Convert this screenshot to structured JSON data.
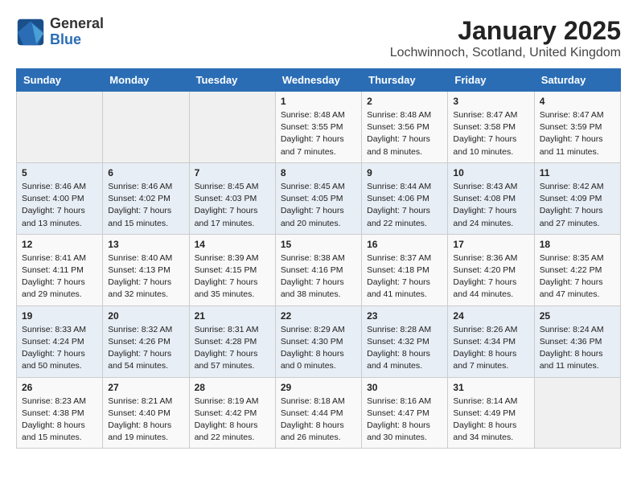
{
  "logo": {
    "general": "General",
    "blue": "Blue"
  },
  "title": "January 2025",
  "location": "Lochwinnoch, Scotland, United Kingdom",
  "days_of_week": [
    "Sunday",
    "Monday",
    "Tuesday",
    "Wednesday",
    "Thursday",
    "Friday",
    "Saturday"
  ],
  "weeks": [
    [
      {
        "day": null
      },
      {
        "day": null
      },
      {
        "day": null
      },
      {
        "day": "1",
        "sunrise": "Sunrise: 8:48 AM",
        "sunset": "Sunset: 3:55 PM",
        "daylight": "Daylight: 7 hours and 7 minutes."
      },
      {
        "day": "2",
        "sunrise": "Sunrise: 8:48 AM",
        "sunset": "Sunset: 3:56 PM",
        "daylight": "Daylight: 7 hours and 8 minutes."
      },
      {
        "day": "3",
        "sunrise": "Sunrise: 8:47 AM",
        "sunset": "Sunset: 3:58 PM",
        "daylight": "Daylight: 7 hours and 10 minutes."
      },
      {
        "day": "4",
        "sunrise": "Sunrise: 8:47 AM",
        "sunset": "Sunset: 3:59 PM",
        "daylight": "Daylight: 7 hours and 11 minutes."
      }
    ],
    [
      {
        "day": "5",
        "sunrise": "Sunrise: 8:46 AM",
        "sunset": "Sunset: 4:00 PM",
        "daylight": "Daylight: 7 hours and 13 minutes."
      },
      {
        "day": "6",
        "sunrise": "Sunrise: 8:46 AM",
        "sunset": "Sunset: 4:02 PM",
        "daylight": "Daylight: 7 hours and 15 minutes."
      },
      {
        "day": "7",
        "sunrise": "Sunrise: 8:45 AM",
        "sunset": "Sunset: 4:03 PM",
        "daylight": "Daylight: 7 hours and 17 minutes."
      },
      {
        "day": "8",
        "sunrise": "Sunrise: 8:45 AM",
        "sunset": "Sunset: 4:05 PM",
        "daylight": "Daylight: 7 hours and 20 minutes."
      },
      {
        "day": "9",
        "sunrise": "Sunrise: 8:44 AM",
        "sunset": "Sunset: 4:06 PM",
        "daylight": "Daylight: 7 hours and 22 minutes."
      },
      {
        "day": "10",
        "sunrise": "Sunrise: 8:43 AM",
        "sunset": "Sunset: 4:08 PM",
        "daylight": "Daylight: 7 hours and 24 minutes."
      },
      {
        "day": "11",
        "sunrise": "Sunrise: 8:42 AM",
        "sunset": "Sunset: 4:09 PM",
        "daylight": "Daylight: 7 hours and 27 minutes."
      }
    ],
    [
      {
        "day": "12",
        "sunrise": "Sunrise: 8:41 AM",
        "sunset": "Sunset: 4:11 PM",
        "daylight": "Daylight: 7 hours and 29 minutes."
      },
      {
        "day": "13",
        "sunrise": "Sunrise: 8:40 AM",
        "sunset": "Sunset: 4:13 PM",
        "daylight": "Daylight: 7 hours and 32 minutes."
      },
      {
        "day": "14",
        "sunrise": "Sunrise: 8:39 AM",
        "sunset": "Sunset: 4:15 PM",
        "daylight": "Daylight: 7 hours and 35 minutes."
      },
      {
        "day": "15",
        "sunrise": "Sunrise: 8:38 AM",
        "sunset": "Sunset: 4:16 PM",
        "daylight": "Daylight: 7 hours and 38 minutes."
      },
      {
        "day": "16",
        "sunrise": "Sunrise: 8:37 AM",
        "sunset": "Sunset: 4:18 PM",
        "daylight": "Daylight: 7 hours and 41 minutes."
      },
      {
        "day": "17",
        "sunrise": "Sunrise: 8:36 AM",
        "sunset": "Sunset: 4:20 PM",
        "daylight": "Daylight: 7 hours and 44 minutes."
      },
      {
        "day": "18",
        "sunrise": "Sunrise: 8:35 AM",
        "sunset": "Sunset: 4:22 PM",
        "daylight": "Daylight: 7 hours and 47 minutes."
      }
    ],
    [
      {
        "day": "19",
        "sunrise": "Sunrise: 8:33 AM",
        "sunset": "Sunset: 4:24 PM",
        "daylight": "Daylight: 7 hours and 50 minutes."
      },
      {
        "day": "20",
        "sunrise": "Sunrise: 8:32 AM",
        "sunset": "Sunset: 4:26 PM",
        "daylight": "Daylight: 7 hours and 54 minutes."
      },
      {
        "day": "21",
        "sunrise": "Sunrise: 8:31 AM",
        "sunset": "Sunset: 4:28 PM",
        "daylight": "Daylight: 7 hours and 57 minutes."
      },
      {
        "day": "22",
        "sunrise": "Sunrise: 8:29 AM",
        "sunset": "Sunset: 4:30 PM",
        "daylight": "Daylight: 8 hours and 0 minutes."
      },
      {
        "day": "23",
        "sunrise": "Sunrise: 8:28 AM",
        "sunset": "Sunset: 4:32 PM",
        "daylight": "Daylight: 8 hours and 4 minutes."
      },
      {
        "day": "24",
        "sunrise": "Sunrise: 8:26 AM",
        "sunset": "Sunset: 4:34 PM",
        "daylight": "Daylight: 8 hours and 7 minutes."
      },
      {
        "day": "25",
        "sunrise": "Sunrise: 8:24 AM",
        "sunset": "Sunset: 4:36 PM",
        "daylight": "Daylight: 8 hours and 11 minutes."
      }
    ],
    [
      {
        "day": "26",
        "sunrise": "Sunrise: 8:23 AM",
        "sunset": "Sunset: 4:38 PM",
        "daylight": "Daylight: 8 hours and 15 minutes."
      },
      {
        "day": "27",
        "sunrise": "Sunrise: 8:21 AM",
        "sunset": "Sunset: 4:40 PM",
        "daylight": "Daylight: 8 hours and 19 minutes."
      },
      {
        "day": "28",
        "sunrise": "Sunrise: 8:19 AM",
        "sunset": "Sunset: 4:42 PM",
        "daylight": "Daylight: 8 hours and 22 minutes."
      },
      {
        "day": "29",
        "sunrise": "Sunrise: 8:18 AM",
        "sunset": "Sunset: 4:44 PM",
        "daylight": "Daylight: 8 hours and 26 minutes."
      },
      {
        "day": "30",
        "sunrise": "Sunrise: 8:16 AM",
        "sunset": "Sunset: 4:47 PM",
        "daylight": "Daylight: 8 hours and 30 minutes."
      },
      {
        "day": "31",
        "sunrise": "Sunrise: 8:14 AM",
        "sunset": "Sunset: 4:49 PM",
        "daylight": "Daylight: 8 hours and 34 minutes."
      },
      {
        "day": null
      }
    ]
  ]
}
